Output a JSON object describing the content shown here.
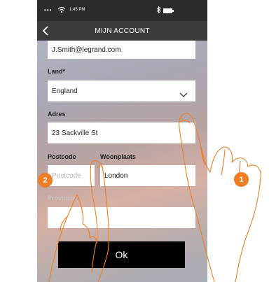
{
  "status_bar": {
    "dots": "•••",
    "time": "1:45 PM",
    "icons": [
      "wifi-icon",
      "bluetooth-icon",
      "battery-icon"
    ]
  },
  "header": {
    "back_icon": "chevron-left-icon",
    "title": "MIJN ACCOUNT"
  },
  "form": {
    "email_value": "J.Smith@legrand.com",
    "land_label": "Land*",
    "land_value": "England",
    "adres_label": "Adres",
    "adres_value": "23 Sackville St",
    "postcode_label": "Postcode",
    "postcode_placeholder": "Postcode",
    "woonplaats_label": "Woonplaats",
    "woonplaats_value": "London",
    "provincie_label": "Provincie",
    "provincie_value": ""
  },
  "ok_label": "Ok",
  "step_badges": [
    "1",
    "2"
  ],
  "colors": {
    "badge": "#ef7d23",
    "navbar": "#3b3b3b",
    "statusbar": "#2b2b2b",
    "button": "#000000"
  }
}
